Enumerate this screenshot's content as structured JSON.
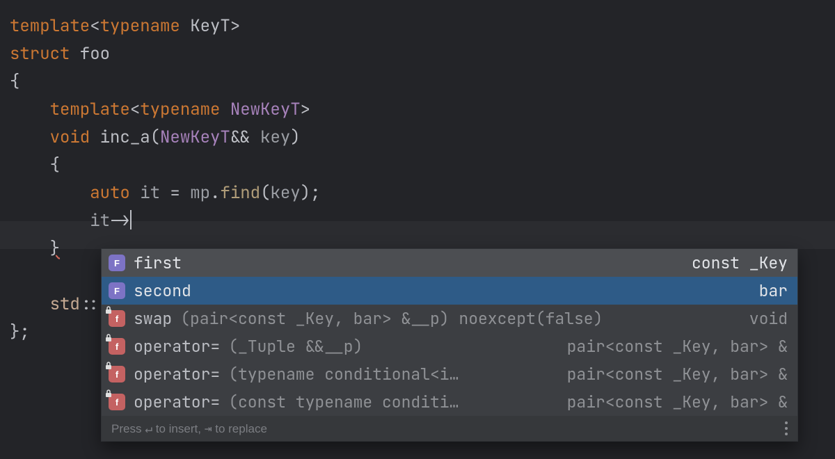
{
  "code": {
    "l1_template": "template",
    "l1_open": "<",
    "l1_typename": "typename",
    "l1_space": " ",
    "l1_KeyT": "KeyT",
    "l1_close": ">",
    "l2_struct": "struct",
    "l2_foo": " foo",
    "l3_brace": "{",
    "l4_template": "template",
    "l4_open": "<",
    "l4_typename": "typename",
    "l4_NewKeyT": " NewKeyT",
    "l4_close": ">",
    "l5_void": "void",
    "l5_inc_a": " inc_a",
    "l5_paren": "(",
    "l5_NewKeyT": "NewKeyT",
    "l5_amp": "&& ",
    "l5_key": "key",
    "l5_paren2": ")",
    "l6_brace": "{",
    "l7_auto": "auto",
    "l7_it": " it ",
    "l7_eq": "= ",
    "l7_mp": "mp",
    "l7_dot": ".",
    "l7_find": "find",
    "l7_paren": "(",
    "l7_key": "key",
    "l7_paren2": ");",
    "l8_it": "it",
    "l8_arrow": "->",
    "l9_brace": "}",
    "l10_std": "std",
    "l10_colcol": "::",
    "l11_close_brace": "};"
  },
  "popup": {
    "items": [
      {
        "icon": "field",
        "name": "first",
        "sig": "",
        "ret": "const _Key"
      },
      {
        "icon": "field",
        "name": "second",
        "sig": "",
        "ret": "bar"
      },
      {
        "icon": "func",
        "name": "swap",
        "sig": "(pair<const _Key, bar> &__p) noexcept(false)",
        "ret": "void"
      },
      {
        "icon": "func",
        "name": "operator=",
        "sig": "(_Tuple &&__p)",
        "ret": "pair<const _Key, bar> &"
      },
      {
        "icon": "func",
        "name": "operator=",
        "sig": "(typename conditional<i…",
        "ret": "pair<const _Key, bar> &"
      },
      {
        "icon": "func",
        "name": "operator=",
        "sig": "(const typename conditi…",
        "ret": "pair<const _Key, bar> &"
      }
    ],
    "hint_pre": "Press ",
    "hint_insert_key": "↵",
    "hint_insert": " to insert, ",
    "hint_replace_key": "⇥",
    "hint_replace": " to replace"
  }
}
